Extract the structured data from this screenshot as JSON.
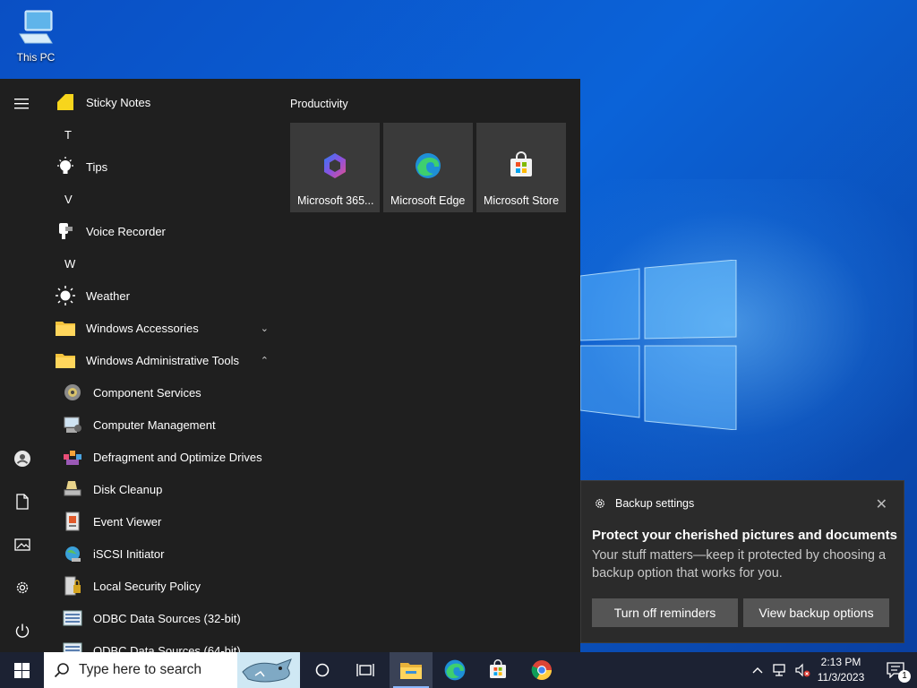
{
  "desktop": {
    "this_pc_label": "This PC"
  },
  "start_menu": {
    "apps": [
      {
        "label": "Sticky Notes"
      },
      {
        "letter": "T"
      },
      {
        "label": "Tips"
      },
      {
        "letter": "V"
      },
      {
        "label": "Voice Recorder"
      },
      {
        "letter": "W"
      },
      {
        "label": "Weather"
      },
      {
        "label": "Windows Accessories",
        "chevron": "⌄"
      },
      {
        "label": "Windows Administrative Tools",
        "chevron": "⌃"
      }
    ],
    "admin_tools": [
      {
        "label": "Component Services"
      },
      {
        "label": "Computer Management"
      },
      {
        "label": "Defragment and Optimize Drives"
      },
      {
        "label": "Disk Cleanup"
      },
      {
        "label": "Event Viewer"
      },
      {
        "label": "iSCSI Initiator"
      },
      {
        "label": "Local Security Policy"
      },
      {
        "label": "ODBC Data Sources (32-bit)"
      },
      {
        "label": "ODBC Data Sources (64-bit)"
      }
    ],
    "group_title": "Productivity",
    "tiles": [
      {
        "label": "Microsoft 365..."
      },
      {
        "label": "Microsoft Edge"
      },
      {
        "label": "Microsoft Store"
      }
    ]
  },
  "toast": {
    "app_name": "Backup settings",
    "title": "Protect your cherished pictures and documents",
    "body": "Your stuff matters—keep it protected by choosing a backup option that works for you.",
    "btn_dismiss": "Turn off reminders",
    "btn_view": "View backup options"
  },
  "taskbar": {
    "search_placeholder": "Type here to search",
    "time": "2:13 PM",
    "date": "11/3/2023",
    "notification_count": "1"
  }
}
